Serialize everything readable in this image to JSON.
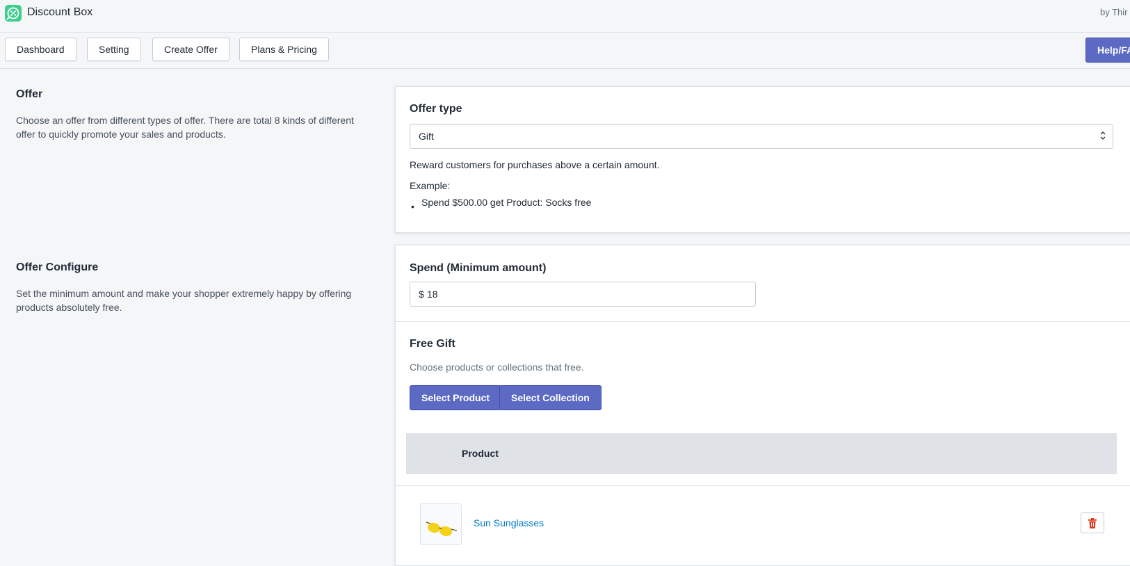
{
  "app": {
    "title": "Discount Box",
    "by_text": "by Thir",
    "brand_color": "#3ecf8e",
    "primary_color": "#5c6ac4"
  },
  "nav": {
    "buttons": [
      "Dashboard",
      "Setting",
      "Create Offer",
      "Plans & Pricing"
    ],
    "help_label": "Help/FA"
  },
  "offer_section": {
    "title": "Offer",
    "description": "Choose an offer from different types of offer. There are total 8 kinds of different offer to quickly promote your sales and products."
  },
  "offer_card": {
    "label": "Offer type",
    "selected": "Gift",
    "description": "Reward customers for purchases above a certain amount.",
    "example_label": "Example:",
    "example_item": "Spend $500.00 get Product: Socks free"
  },
  "configure_section": {
    "title": "Offer Configure",
    "description": "Set the minimum amount and make your shopper extremely happy by offering products absolutely free."
  },
  "spend": {
    "label": "Spend (Minimum amount)",
    "prefix": "$",
    "value": "18"
  },
  "free_gift": {
    "label": "Free Gift",
    "description": "Choose products or collections that free.",
    "select_product_label": "Select Product",
    "select_collection_label": "Select Collection",
    "table_header": "Product",
    "products": [
      {
        "name": "Sun Sunglasses",
        "thumbnail_icon": "sunglasses-icon"
      }
    ]
  }
}
